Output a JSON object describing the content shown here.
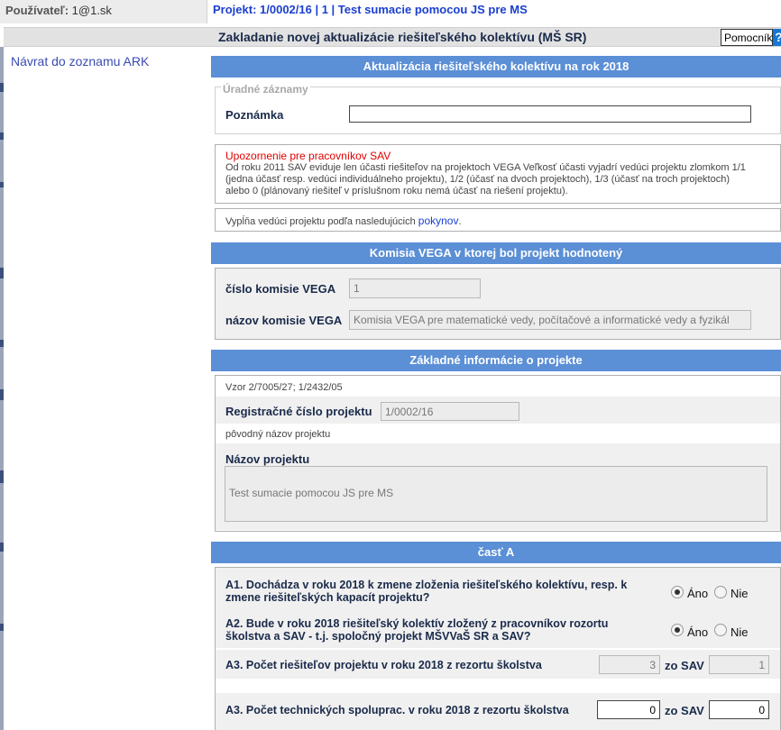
{
  "header": {
    "user_label": "Používateľ:",
    "user_value": "1@1.sk",
    "project_text": "Projekt:  1/0002/16 | 1 | Test sumacie pomocou JS pre MS"
  },
  "titlebar": {
    "title": "Zakladanie novej aktualizácie riešiteľského kolektívu (MŠ SR)",
    "help_button": "Pomocník",
    "help_icon": "?"
  },
  "nav": {
    "back_link": "Návrat do zoznamu ARK"
  },
  "section1": {
    "heading": "Aktualizácia riešiteľského kolektívu na rok 2018",
    "fieldset_legend": "Úradné záznamy",
    "note_label": "Poznámka",
    "note_value": ""
  },
  "warning": {
    "title": "Upozornenie pre pracovníkov SAV",
    "line1": "Od roku 2011 SAV eviduje len účasti riešiteľov na projektoch VEGA Veľkosť účasti vyjadrí vedúci projektu zlomkom 1/1",
    "line2": "(jedna účasť resp. vedúci individuálneho projektu), 1/2 (účasť na dvoch projektoch), 1/3 (účasť na troch projektoch)",
    "line3": "alebo 0 (plánovaný riešiteľ v príslušnom roku nemá účasť na riešení projektu)."
  },
  "instructions": {
    "text": "Vypĺňa vedúci projektu podľa nasledujúcich",
    "link": "pokynov",
    "end": "."
  },
  "section2": {
    "heading": "Komisia VEGA v ktorej bol projekt hodnotený",
    "commission_number_label": "číslo komisie VEGA",
    "commission_number_value": "1",
    "commission_name_label": "názov komisie VEGA",
    "commission_name_value": "Komisia VEGA pre matematické vedy, počítačové a informatické vedy a fyzikál"
  },
  "section3": {
    "heading": "Základné informácie o projekte",
    "pattern_hint": "Vzor 2/7005/27; 1/2432/05",
    "reg_label": "Registračné číslo projektu",
    "reg_value": "1/0002/16",
    "original_name_hint": "pôvodný názov projektu",
    "name_label": "Názov projektu",
    "name_value": "Test sumacie pomocou JS pre MS"
  },
  "section4": {
    "heading": "časť A",
    "q1_line1": "A1. Dochádza v roku 2018 k zmene zloženia riešiteľského kolektívu, resp. k",
    "q1_line2": "zmene riešiteľských kapacít projektu?",
    "q2_line1": "A2. Bude v roku 2018 riešiteľský kolektív zložený z pracovníkov rozortu",
    "q2_line2": "školstva a SAV - t.j. spoločný projekt MŠVVaŠ SR a SAV?",
    "yes_label": "Áno",
    "no_label": "Nie",
    "q1_answer": "Áno",
    "q2_answer": "Áno",
    "q3_label": "A3. Počet riešiteľov projektu v roku 2018 z rezortu školstva",
    "q3_value": "3",
    "q3_sav_label": "zo SAV",
    "q3_sav_value": "1",
    "q4_label": "A3. Počet technických spoluprac. v roku 2018 z rezortu školstva",
    "q4_value": "0",
    "q4_sav_label": "zo SAV",
    "q4_sav_value": "0"
  }
}
